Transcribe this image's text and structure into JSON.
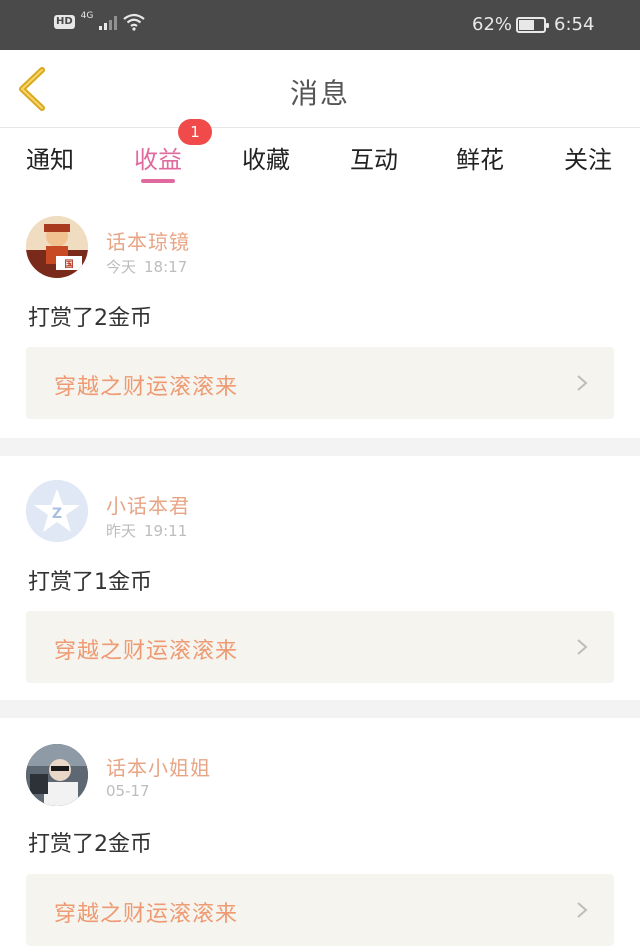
{
  "status_bar": {
    "hd": "HD",
    "network": "4G",
    "battery_text": "62%",
    "battery_level": 0.62,
    "time": "6:54"
  },
  "header": {
    "title": "消息"
  },
  "tabs": [
    {
      "label": "通知"
    },
    {
      "label": "收益",
      "active": true,
      "badge": "1"
    },
    {
      "label": "收藏"
    },
    {
      "label": "互动"
    },
    {
      "label": "鲜花"
    },
    {
      "label": "关注"
    }
  ],
  "messages": [
    {
      "user": "话本琼镜",
      "date": "今天",
      "time": "18:17",
      "text": "打赏了2金币",
      "promo": "穿越之财运滚滚来"
    },
    {
      "user": "小话本君",
      "date": "昨天",
      "time": "19:11",
      "text": "打赏了1金币",
      "promo": "穿越之财运滚滚来"
    },
    {
      "user": "话本小姐姐",
      "date": "05-17",
      "time": "",
      "text": "打赏了2金币",
      "promo": "穿越之财运滚滚来"
    }
  ],
  "colors": {
    "accent": "#e06a9e",
    "badge": "#f04a4a",
    "username": "#e8a585",
    "promo_text": "#ee9a72",
    "promo_bg": "#f5f4ef",
    "back_arrow": "#d9a81e"
  }
}
